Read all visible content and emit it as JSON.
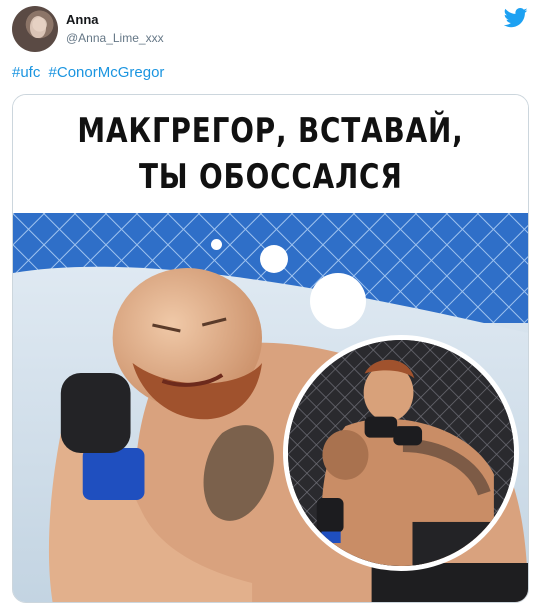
{
  "tweet": {
    "author_name": "Anna",
    "author_handle": "@Anna_Lime_xxx",
    "hashtags": [
      "#ufc",
      "#ConorMcGregor"
    ]
  },
  "meme": {
    "caption_line_1": "МАКГРЕГОР, ВСТАВАЙ,",
    "caption_line_2": "ТЫ ОБОССАЛСЯ"
  },
  "icons": {
    "brand": "twitter-bird-icon"
  },
  "colors": {
    "link": "#1b95e0",
    "twitter_brand": "#1da1f2",
    "handle_text": "#657786"
  }
}
